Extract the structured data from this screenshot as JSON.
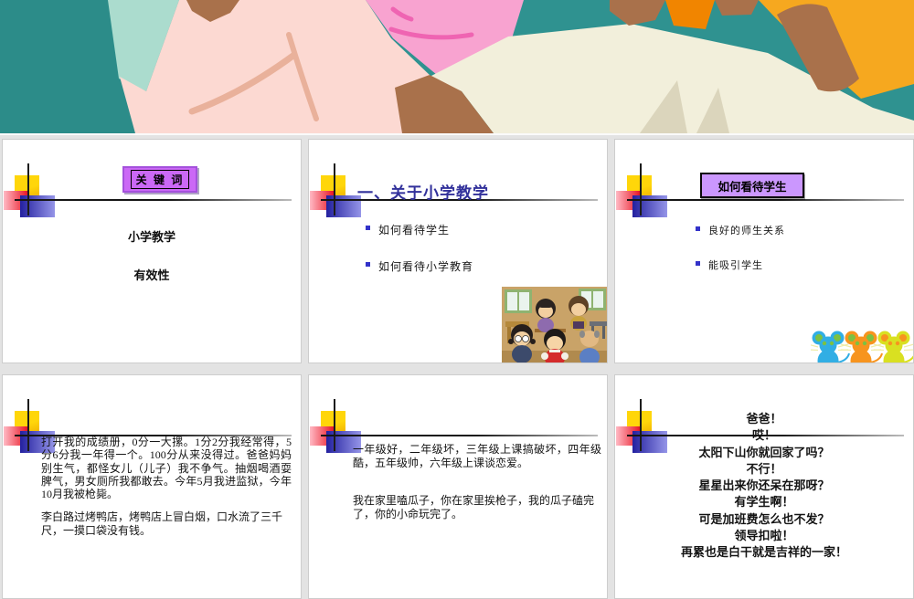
{
  "banner": {
    "kind": "cropped-cartoon-illustration",
    "palette": {
      "teal": "#2F9290",
      "teal_dark": "#2C8C89",
      "mint": "#ABDCCE",
      "light_pink": "#FCD9D2",
      "salmon_crease": "#E9B19B",
      "hot_pink": "#F8A3D0",
      "magenta_crease": "#EF64B2",
      "skin_brown": "#A9714B",
      "cream": "#F2EFDB",
      "cream_shadow": "#DBD5BC",
      "orange": "#F18500",
      "amber": "#F6A81F"
    }
  },
  "ui_colors": {
    "sorter_background": "#E3E3E3",
    "slide_background": "#FFFFFF",
    "title_color": "#32319B",
    "bullet_square": "#3332C9",
    "box1_fill": "#CB68F6",
    "box3_fill": "#CB97FE",
    "accent_yellow": "#FFD60A",
    "accent_red": "#E81120",
    "accent_blue": "#23209F"
  },
  "slides": [
    {
      "number": 1,
      "title_box": "关 键 词",
      "lines": [
        "小学教学",
        "有效性"
      ]
    },
    {
      "number": 2,
      "title": "一、关于小学教学",
      "bullets": [
        "如何看待学生",
        "如何看待小学教育"
      ],
      "image": "classroom-figurines"
    },
    {
      "number": 3,
      "title_box": "如何看待学生",
      "bullets": [
        "良好的师生关系",
        "能吸引学生"
      ],
      "image": "three-mice"
    },
    {
      "number": 4,
      "paragraphs": [
        "打开我的成绩册，0分一大摞。1分2分我经常得，5分6分我一年得一个。100分从来没得过。爸爸妈妈别生气，都怪女儿（儿子）我不争气。抽烟喝酒耍脾气，男女厕所我都敢去。今年5月我进监狱，今年10月我被枪毙。",
        "李白路过烤鸭店，烤鸭店上冒白烟，口水流了三千尺，一摸口袋没有钱。"
      ]
    },
    {
      "number": 5,
      "paragraphs": [
        "一年级好，二年级坏，三年级上课搞破坏，四年级酷，五年级帅，六年级上课谈恋爱。",
        "我在家里嗑瓜子，你在家里挨枪子，我的瓜子磕完了，你的小命玩完了。"
      ]
    },
    {
      "number": 6,
      "lines": [
        "爸爸！",
        "哎！",
        "太阳下山你就回家了吗？",
        "不行！",
        "星星出来你还呆在那呀？",
        "有学生啊！",
        "可是加班费怎么也不发？",
        "领导扣啦！",
        "再累也是白干就是吉祥的一家！"
      ]
    }
  ]
}
